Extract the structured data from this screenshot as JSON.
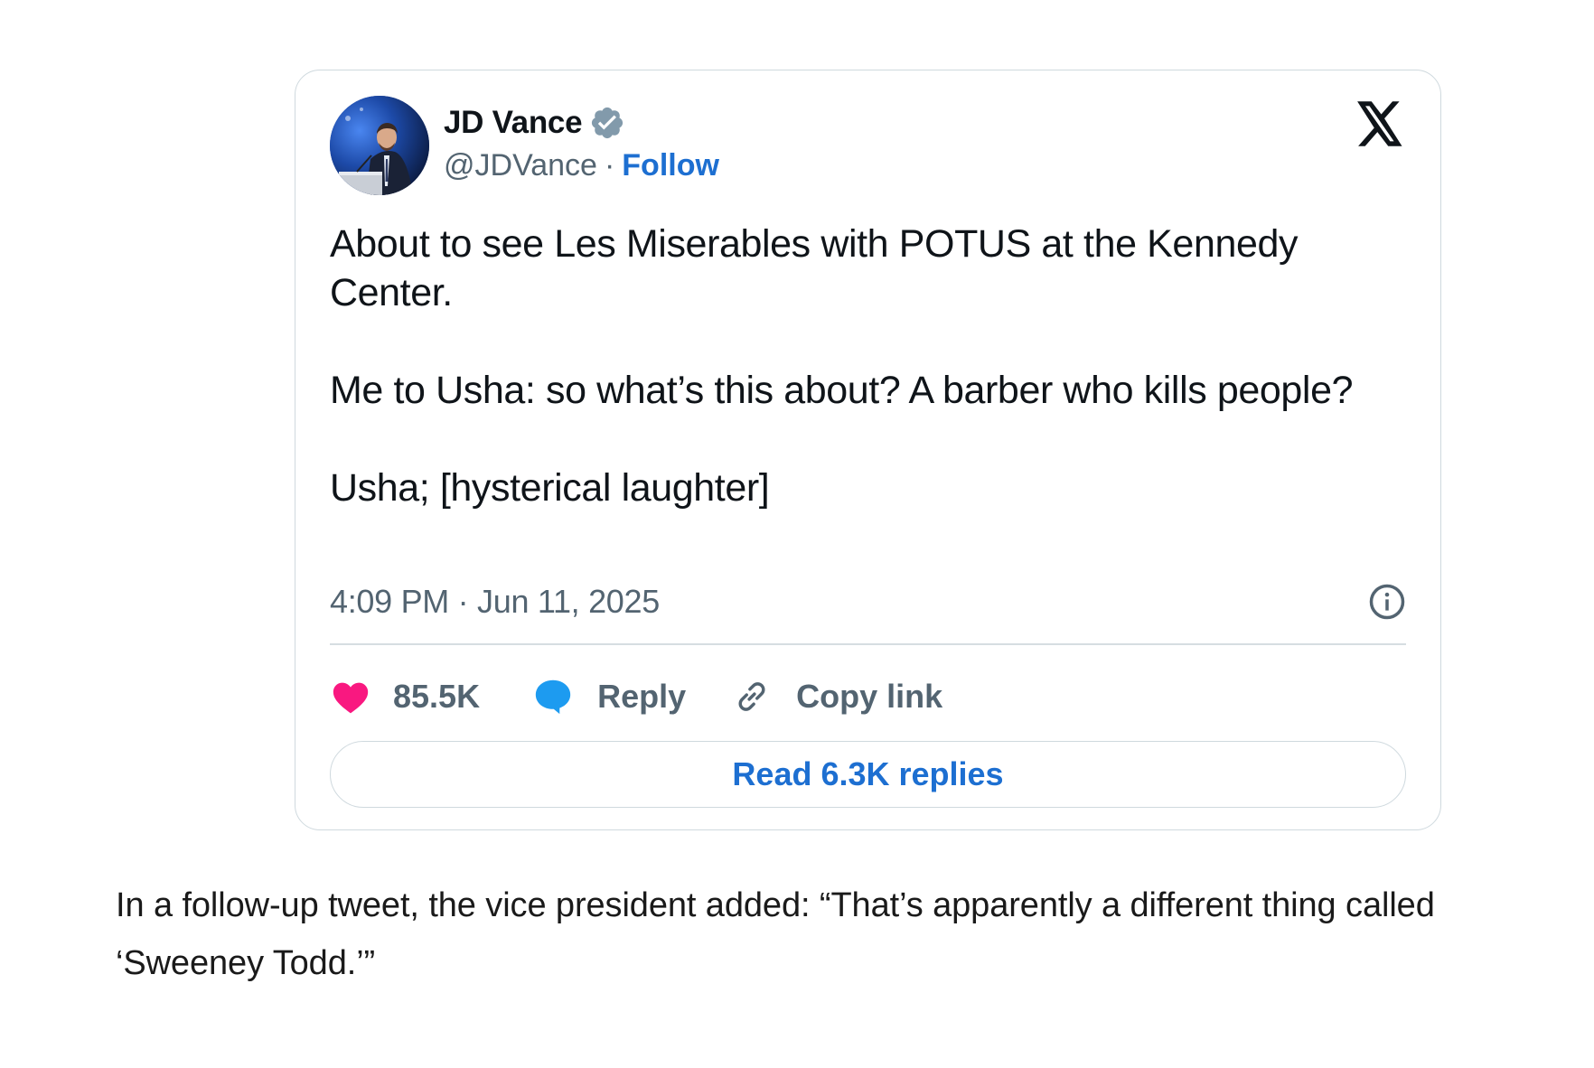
{
  "tweet": {
    "author": {
      "display_name": "JD Vance",
      "handle": "@JDVance",
      "verified": true,
      "avatar_icon": "person-at-podium-avatar"
    },
    "follow_label": "Follow",
    "separator": "·",
    "platform_icon": "x-logo-icon",
    "text_paragraphs": [
      "About to see Les Miserables with POTUS at the Kennedy Center.",
      "Me to Usha: so what’s this about? A barber who kills people?",
      "Usha; [hysterical laughter]"
    ],
    "timestamp": "4:09 PM · Jun 11, 2025",
    "actions": {
      "likes": "85.5K",
      "reply_label": "Reply",
      "copy_link_label": "Copy link"
    },
    "read_replies_label": "Read 6.3K replies",
    "colors": {
      "accent_link": "#1d6fd1",
      "like_heart": "#f91880",
      "reply_bubble": "#1d9bf0",
      "verified_badge": "#829aab",
      "muted_text": "#536471"
    }
  },
  "article": {
    "caption": "In a follow-up tweet, the vice president added: “That’s apparently a different thing called ‘Sweeney Todd.’”"
  }
}
